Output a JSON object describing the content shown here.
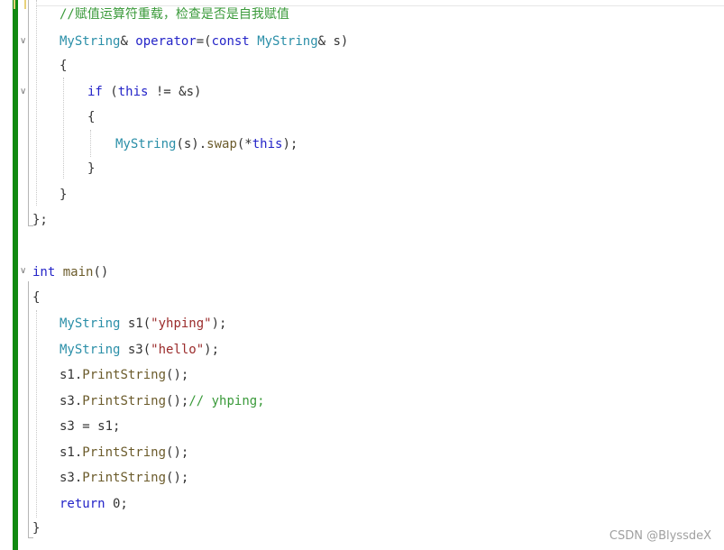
{
  "editor": {
    "lines": [
      {
        "id": "l1",
        "parts": [
          {
            "t": "//赋值运算符重载，检查是否是自我赋值",
            "c": "cm"
          }
        ]
      },
      {
        "id": "l2",
        "parts": [
          {
            "t": "MyString",
            "c": "ty"
          },
          {
            "t": "& ",
            "c": "pl"
          },
          {
            "t": "operator",
            "c": "kw"
          },
          {
            "t": "=(",
            "c": "pl"
          },
          {
            "t": "const",
            "c": "kw"
          },
          {
            "t": " ",
            "c": "pl"
          },
          {
            "t": "MyString",
            "c": "ty"
          },
          {
            "t": "& s)",
            "c": "pl"
          }
        ]
      },
      {
        "id": "l3",
        "parts": [
          {
            "t": "{",
            "c": "pl"
          }
        ]
      },
      {
        "id": "l4",
        "parts": [
          {
            "t": "if",
            "c": "kw"
          },
          {
            "t": " (",
            "c": "pl"
          },
          {
            "t": "this",
            "c": "kw"
          },
          {
            "t": " != &s)",
            "c": "pl"
          }
        ]
      },
      {
        "id": "l5",
        "parts": [
          {
            "t": "{",
            "c": "pl"
          }
        ]
      },
      {
        "id": "l6",
        "parts": [
          {
            "t": "MyString",
            "c": "ty"
          },
          {
            "t": "(s).",
            "c": "pl"
          },
          {
            "t": "swap",
            "c": "fn"
          },
          {
            "t": "(*",
            "c": "pl"
          },
          {
            "t": "this",
            "c": "kw"
          },
          {
            "t": ");",
            "c": "pl"
          }
        ]
      },
      {
        "id": "l7",
        "parts": [
          {
            "t": "}",
            "c": "pl"
          }
        ]
      },
      {
        "id": "l8",
        "parts": [
          {
            "t": "}",
            "c": "pl"
          }
        ]
      },
      {
        "id": "l9",
        "parts": [
          {
            "t": "};",
            "c": "pl"
          }
        ]
      },
      {
        "id": "l10",
        "parts": [
          {
            "t": "int",
            "c": "kw"
          },
          {
            "t": " ",
            "c": "pl"
          },
          {
            "t": "main",
            "c": "fn"
          },
          {
            "t": "()",
            "c": "pl"
          }
        ]
      },
      {
        "id": "l11",
        "parts": [
          {
            "t": "{",
            "c": "pl"
          }
        ]
      },
      {
        "id": "l12",
        "parts": [
          {
            "t": "MyString",
            "c": "ty"
          },
          {
            "t": " s1(",
            "c": "pl"
          },
          {
            "t": "\"yhping\"",
            "c": "st"
          },
          {
            "t": ");",
            "c": "pl"
          }
        ]
      },
      {
        "id": "l13",
        "parts": [
          {
            "t": "MyString",
            "c": "ty"
          },
          {
            "t": " s3(",
            "c": "pl"
          },
          {
            "t": "\"hello\"",
            "c": "st"
          },
          {
            "t": ");",
            "c": "pl"
          }
        ]
      },
      {
        "id": "l14",
        "parts": [
          {
            "t": "s1.",
            "c": "pl"
          },
          {
            "t": "PrintString",
            "c": "fn"
          },
          {
            "t": "();",
            "c": "pl"
          }
        ]
      },
      {
        "id": "l15",
        "parts": [
          {
            "t": "s3.",
            "c": "pl"
          },
          {
            "t": "PrintString",
            "c": "fn"
          },
          {
            "t": "();",
            "c": "pl"
          },
          {
            "t": "// yhping;",
            "c": "cm"
          }
        ]
      },
      {
        "id": "l16",
        "parts": [
          {
            "t": "s3 = s1;",
            "c": "pl"
          }
        ]
      },
      {
        "id": "l17",
        "parts": [
          {
            "t": "s1.",
            "c": "pl"
          },
          {
            "t": "PrintString",
            "c": "fn"
          },
          {
            "t": "();",
            "c": "pl"
          }
        ]
      },
      {
        "id": "l18",
        "parts": [
          {
            "t": "s3.",
            "c": "pl"
          },
          {
            "t": "PrintString",
            "c": "fn"
          },
          {
            "t": "();",
            "c": "pl"
          }
        ]
      },
      {
        "id": "l19",
        "parts": [
          {
            "t": "return",
            "c": "kw"
          },
          {
            "t": " 0;",
            "c": "pl"
          }
        ]
      },
      {
        "id": "l20",
        "parts": [
          {
            "t": "}",
            "c": "pl"
          }
        ]
      }
    ],
    "fold_icon": "chevron-down-icon"
  },
  "watermark": "CSDN @BlyssdeX",
  "colors": {
    "comment": "#3a9a3a",
    "keyword": "#2424c8",
    "type": "#2b8fa8",
    "function": "#6b5b2b",
    "string": "#9b2c2c",
    "plain": "#333333",
    "change_bar": "#108a10"
  }
}
